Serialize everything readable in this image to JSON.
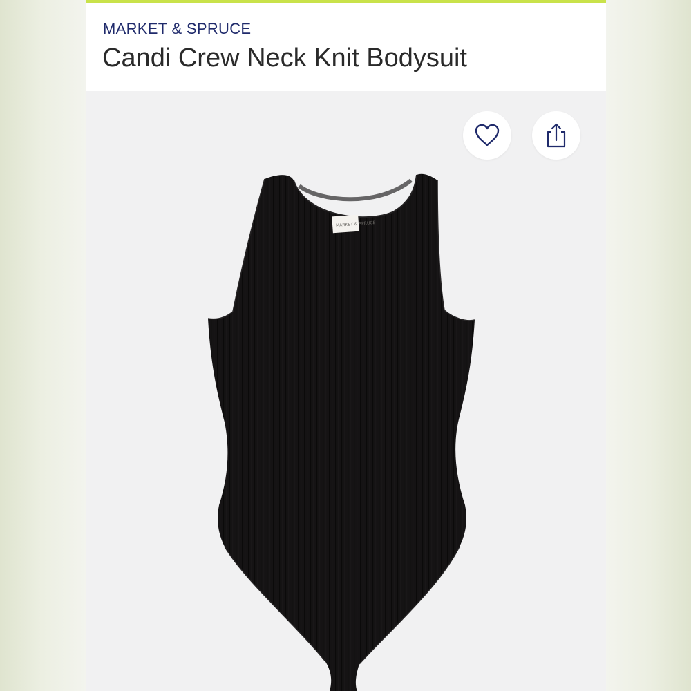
{
  "header": {
    "brand": "MARKET & SPRUCE",
    "title": "Candi Crew Neck Knit Bodysuit"
  },
  "product_image": {
    "garment_label_text": "MARKET & SPRUCE"
  },
  "actions": {
    "favorite_icon": "heart-icon",
    "share_icon": "share-icon"
  },
  "colors": {
    "accent": "#c9e24a",
    "brand_text": "#1f2a6b",
    "icon": "#1f2a6b",
    "garment": "#141213"
  }
}
